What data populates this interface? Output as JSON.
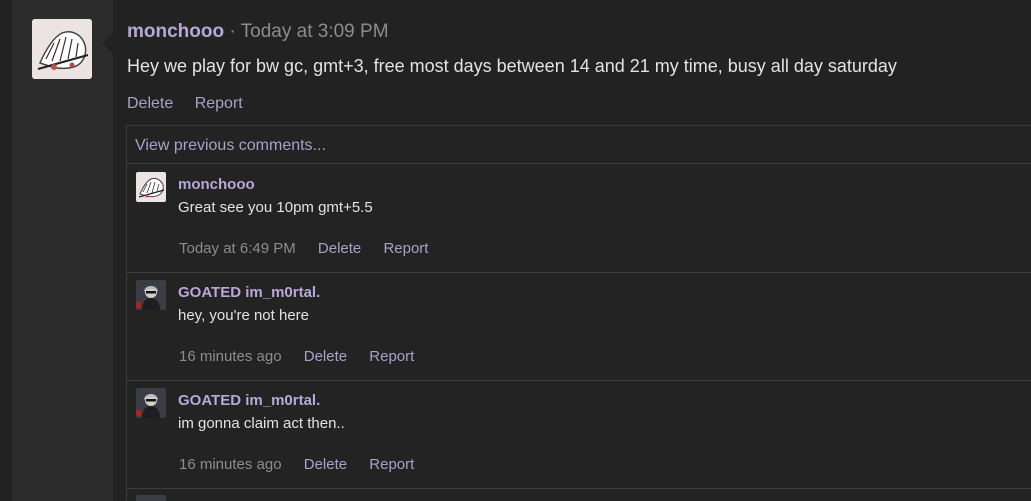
{
  "post": {
    "author": "monchooo",
    "separator": "·",
    "timestamp": "Today at 3:09 PM",
    "body": "Hey we play for bw gc, gmt+3, free most days between 14 and 21 my time, busy all day saturday",
    "actions": {
      "delete": "Delete",
      "report": "Report"
    }
  },
  "comments_section": {
    "view_previous": "View previous comments...",
    "items": [
      {
        "author": "monchooo",
        "text": "Great see you 10pm gmt+5.5",
        "time": "Today at 6:49 PM",
        "delete": "Delete",
        "report": "Report"
      },
      {
        "author": "GOATED im_m0rtal.",
        "text": "hey, you're not here",
        "time": "16 minutes ago",
        "delete": "Delete",
        "report": "Report"
      },
      {
        "author": "GOATED im_m0rtal.",
        "text": "im gonna claim act then..",
        "time": "16 minutes ago",
        "delete": "Delete",
        "report": "Report"
      }
    ]
  },
  "colors": {
    "username": "#b8a8d9",
    "link": "#a9a1c9",
    "muted": "#8c8c8c",
    "text": "#e3e3e3"
  },
  "icons": {
    "main_avatar": "sketch-avatar-icon",
    "user_avatar": "profile-avatar-icon"
  }
}
